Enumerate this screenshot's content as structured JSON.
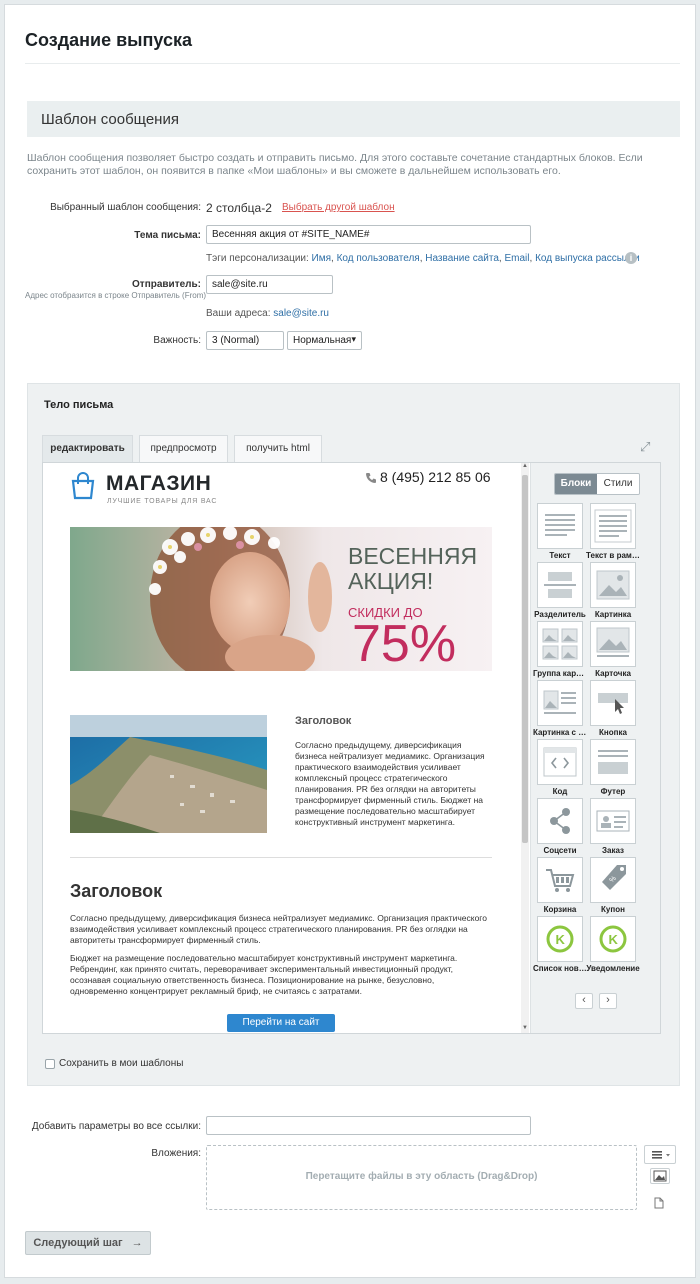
{
  "page_title": "Создание выпуска",
  "section_title": "Шаблон сообщения",
  "description": "Шаблон сообщения позволяет быстро создать и отправить письмо. Для этого составьте сочетание стандартных блоков. Если сохранить этот шаблон, он появится в папке «Мои шаблоны» и вы сможете в дальнейшем использовать его.",
  "template": {
    "label": "Выбранный шаблон сообщения:",
    "value": "2 столбца-2",
    "change_link": "Выбрать другой шаблон"
  },
  "subject": {
    "label": "Тема письма:",
    "value": "Весенняя акция от  #SITE_NAME#",
    "tags_label": "Тэги персонализации:",
    "tags": [
      "Имя",
      "Код пользователя",
      "Название сайта",
      "Email",
      "Код выпуска рассылки"
    ],
    "info_icon": "i"
  },
  "sender": {
    "label": "Отправитель:",
    "hint": "Адрес отобразится в строке Отправитель (From)",
    "value": "sale@site.ru",
    "addresses_label": "Ваши адреса:",
    "address": "sale@site.ru"
  },
  "priority": {
    "label": "Важность:",
    "value": "3 (Normal)",
    "select": "Нормальная",
    "arrow": "▾"
  },
  "body": {
    "title": "Тело письма",
    "tabs": [
      "редактировать",
      "предпросмотр",
      "получить html"
    ],
    "active_tab": 0,
    "expand_icon": "⤢"
  },
  "email": {
    "logo": "МАГАЗИН",
    "logo_sub": "ЛУЧШИЕ ТОВАРЫ ДЛЯ ВАС",
    "phone": "8 (495) 212 85 06",
    "hero_line1": "ВЕСЕННЯЯ",
    "hero_line2": "АКЦИЯ!",
    "hero_line3": "СКИДКИ ДО",
    "hero_percent": "75%",
    "article_title": "Заголовок",
    "article_text": "Согласно предыдущему, диверсификация бизнеса нейтрализует медиамикс. Организация практического взаимодействия усиливает комплексный процесс стратегического планирования. PR без оглядки на авторитеты трансформирует фирменный стиль. Бюджет на размещение последовательно масштабирует конструктивный инструмент маркетинга.",
    "heading": "Заголовок",
    "para1": "Согласно предыдущему, диверсификация бизнеса нейтрализует медиамикс. Организация практического взаимодействия усиливает комплексный процесс стратегического планирования. PR без оглядки на авторитеты трансформирует фирменный стиль.",
    "para2": "Бюджет на размещение последовательно масштабирует конструктивный инструмент маркетинга. Ребрендинг, как принято считать, переворачивает экспериментальный инвестиционный продукт, осознавая социальную ответственность бизнеса. Позиционирование на рынке, безусловно, одновременно концентрирует рекламный бриф, не считаясь с затратами.",
    "cta": "Перейти на сайт"
  },
  "blocks_panel": {
    "seg_blocks": "Блоки",
    "seg_styles": "Стили",
    "items": [
      {
        "label": "Текст",
        "icon": "text-icon"
      },
      {
        "label": "Текст в рамке",
        "icon": "framed-text-icon"
      },
      {
        "label": "Разделитель",
        "icon": "divider-icon"
      },
      {
        "label": "Картинка",
        "icon": "image-icon"
      },
      {
        "label": "Группа картинок",
        "icon": "image-group-icon"
      },
      {
        "label": "Карточка",
        "icon": "card-icon"
      },
      {
        "label": "Картинка с текстом",
        "icon": "image-text-icon"
      },
      {
        "label": "Кнопка",
        "icon": "button-icon"
      },
      {
        "label": "Код",
        "icon": "code-icon"
      },
      {
        "label": "Футер",
        "icon": "footer-icon"
      },
      {
        "label": "Соцсети",
        "icon": "share-icon"
      },
      {
        "label": "Заказ",
        "icon": "order-icon"
      },
      {
        "label": "Корзина",
        "icon": "cart-icon"
      },
      {
        "label": "Купон",
        "icon": "coupon-icon"
      },
      {
        "label": "Список новинок",
        "icon": "k-icon"
      },
      {
        "label": "Уведомление",
        "icon": "k-icon"
      }
    ],
    "prev": "‹",
    "next": "›"
  },
  "save_template": "Сохранить в мои шаблоны",
  "link_params": {
    "label": "Добавить параметры во все ссылки:",
    "value": ""
  },
  "attachments": {
    "label": "Вложения:",
    "dropzone": "Перетащите файлы в эту область (Drag&Drop)"
  },
  "next_button": "Следующий шаг",
  "next_arrow": "→"
}
